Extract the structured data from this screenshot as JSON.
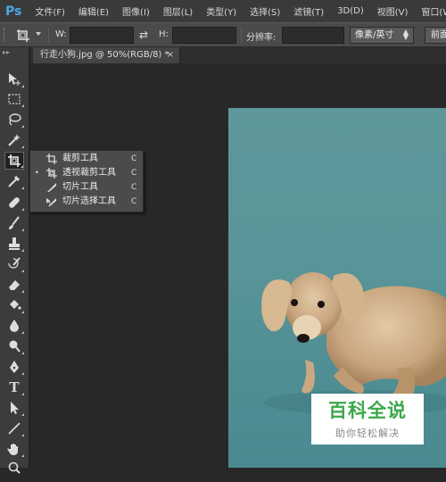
{
  "app": {
    "logo": "Ps"
  },
  "menubar": {
    "items": [
      "文件(F)",
      "编辑(E)",
      "图像(I)",
      "图层(L)",
      "类型(Y)",
      "选择(S)",
      "滤镜(T)",
      "3D(D)",
      "视图(V)",
      "窗口(W)"
    ]
  },
  "options": {
    "width_label": "W:",
    "height_label": "H:",
    "resolution_label": "分辨率:",
    "unit_value": "像素/英寸",
    "front_button": "前面的"
  },
  "document": {
    "tab_title": "行走小狗.jpg @ 50%(RGB/8) *",
    "close": "×"
  },
  "flyout": {
    "items": [
      {
        "label": "裁剪工具",
        "shortcut": "C",
        "selected": false,
        "icon": "crop-icon"
      },
      {
        "label": "透视裁剪工具",
        "shortcut": "C",
        "selected": true,
        "icon": "perspective-crop-icon"
      },
      {
        "label": "切片工具",
        "shortcut": "C",
        "selected": false,
        "icon": "slice-icon"
      },
      {
        "label": "切片选择工具",
        "shortcut": "C",
        "selected": false,
        "icon": "slice-select-icon"
      }
    ],
    "bullet": "•"
  },
  "watermark": {
    "title": "百科全说",
    "subtitle": "助你轻松解决",
    "title_color": "#3aa84a"
  },
  "colors": {
    "menubar": "#3a3a3a",
    "optionsbar": "#4a4a4a",
    "workspace": "#282828",
    "photo_bg": "#5a9599"
  }
}
